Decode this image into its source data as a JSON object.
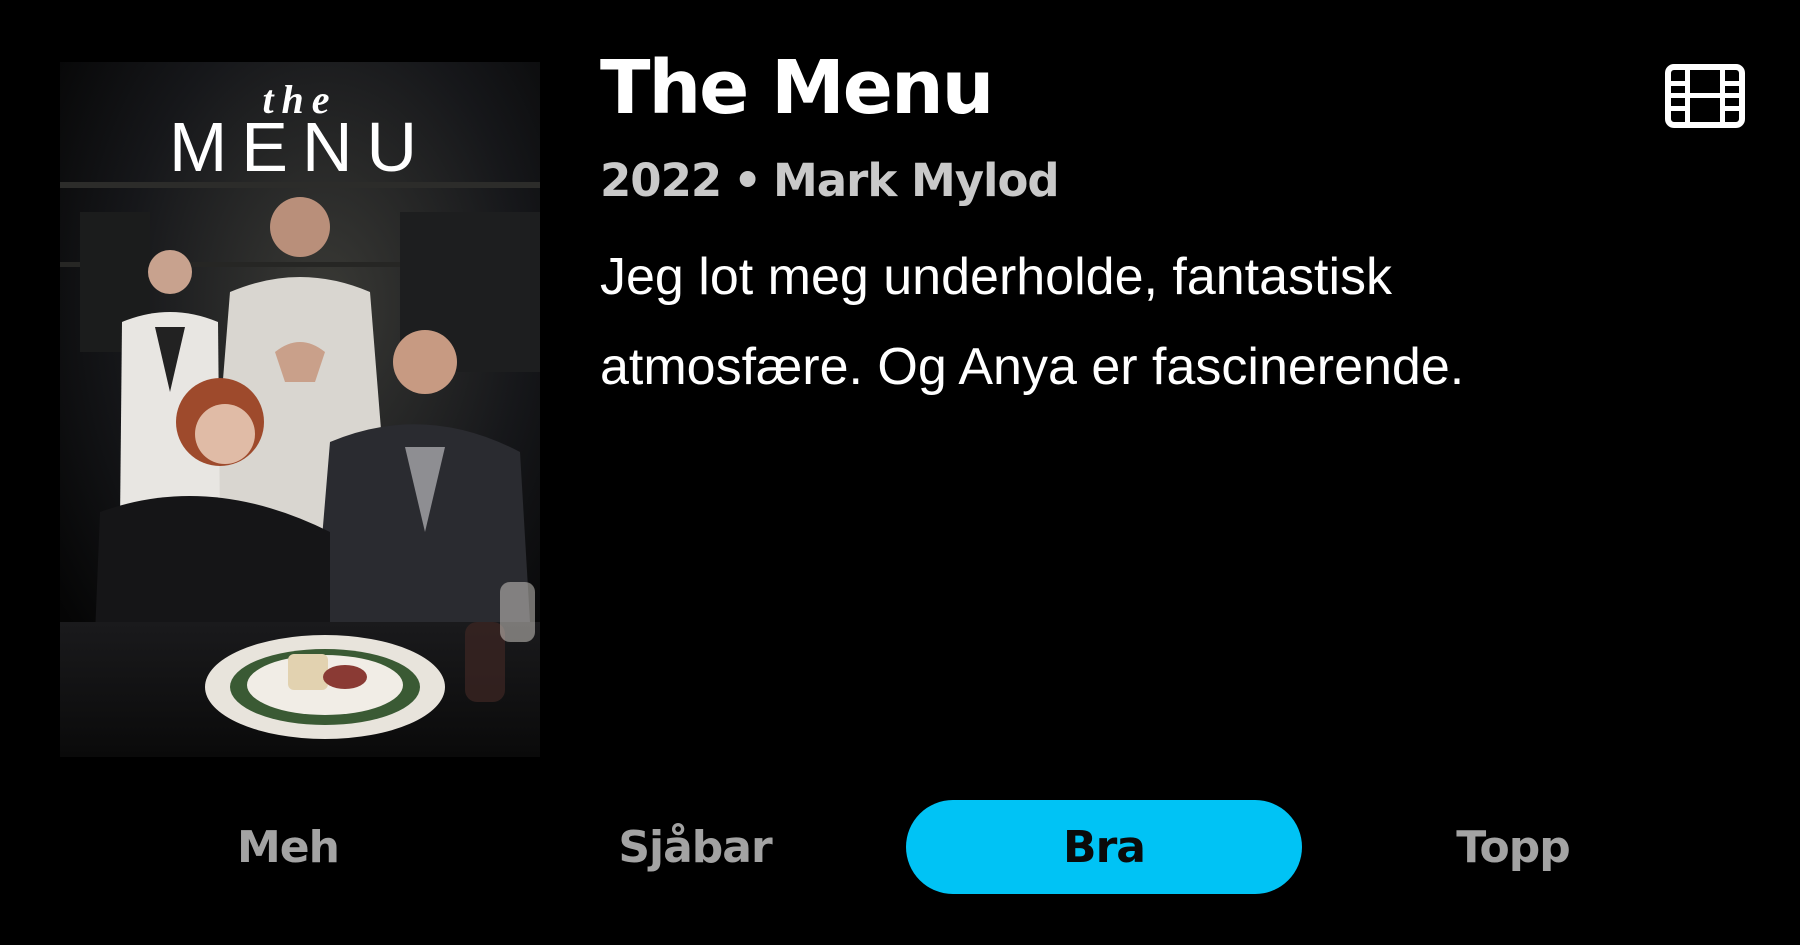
{
  "poster": {
    "title_small": "the",
    "title_large": "MENU"
  },
  "movie": {
    "title": "The Menu",
    "year": "2022",
    "separator": "•",
    "director": "Mark Mylod",
    "review": "Jeg lot meg underholde, fantastisk atmosfære. Og Anya er fascinerende."
  },
  "icons": {
    "film": "film-icon"
  },
  "ratings": {
    "options": [
      "Meh",
      "Sjåbar",
      "Bra",
      "Topp"
    ],
    "selected": "Bra"
  },
  "colors": {
    "background": "#000000",
    "accent": "#00c3f5",
    "meta_text": "#c9c9c9",
    "inactive_rating": "#a3a3a3"
  }
}
